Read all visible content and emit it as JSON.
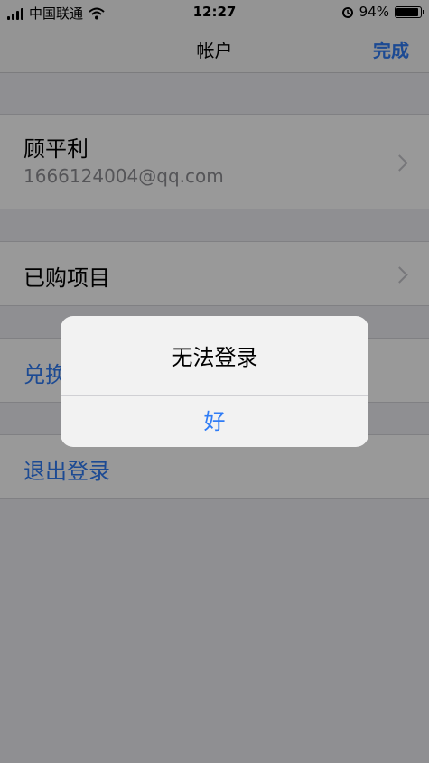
{
  "status_bar": {
    "carrier": "中国联通",
    "time": "12:27",
    "battery_text": "94%",
    "battery_level": 0.94,
    "icons": [
      "signal-icon",
      "wifi-icon",
      "alarm-icon",
      "battery-icon"
    ]
  },
  "nav": {
    "title": "帐户",
    "done_label": "完成"
  },
  "account": {
    "name": "顾平利",
    "email": "1666124004@qq.com"
  },
  "purchases": {
    "label": "已购项目"
  },
  "redeem": {
    "label": "兑换"
  },
  "signout": {
    "label": "退出登录"
  },
  "alert": {
    "title": "无法登录",
    "ok_label": "好"
  },
  "colors": {
    "accent": "#2f7cf6",
    "background": "#efeff4",
    "overlay": "rgba(0,0,0,0.40)"
  }
}
